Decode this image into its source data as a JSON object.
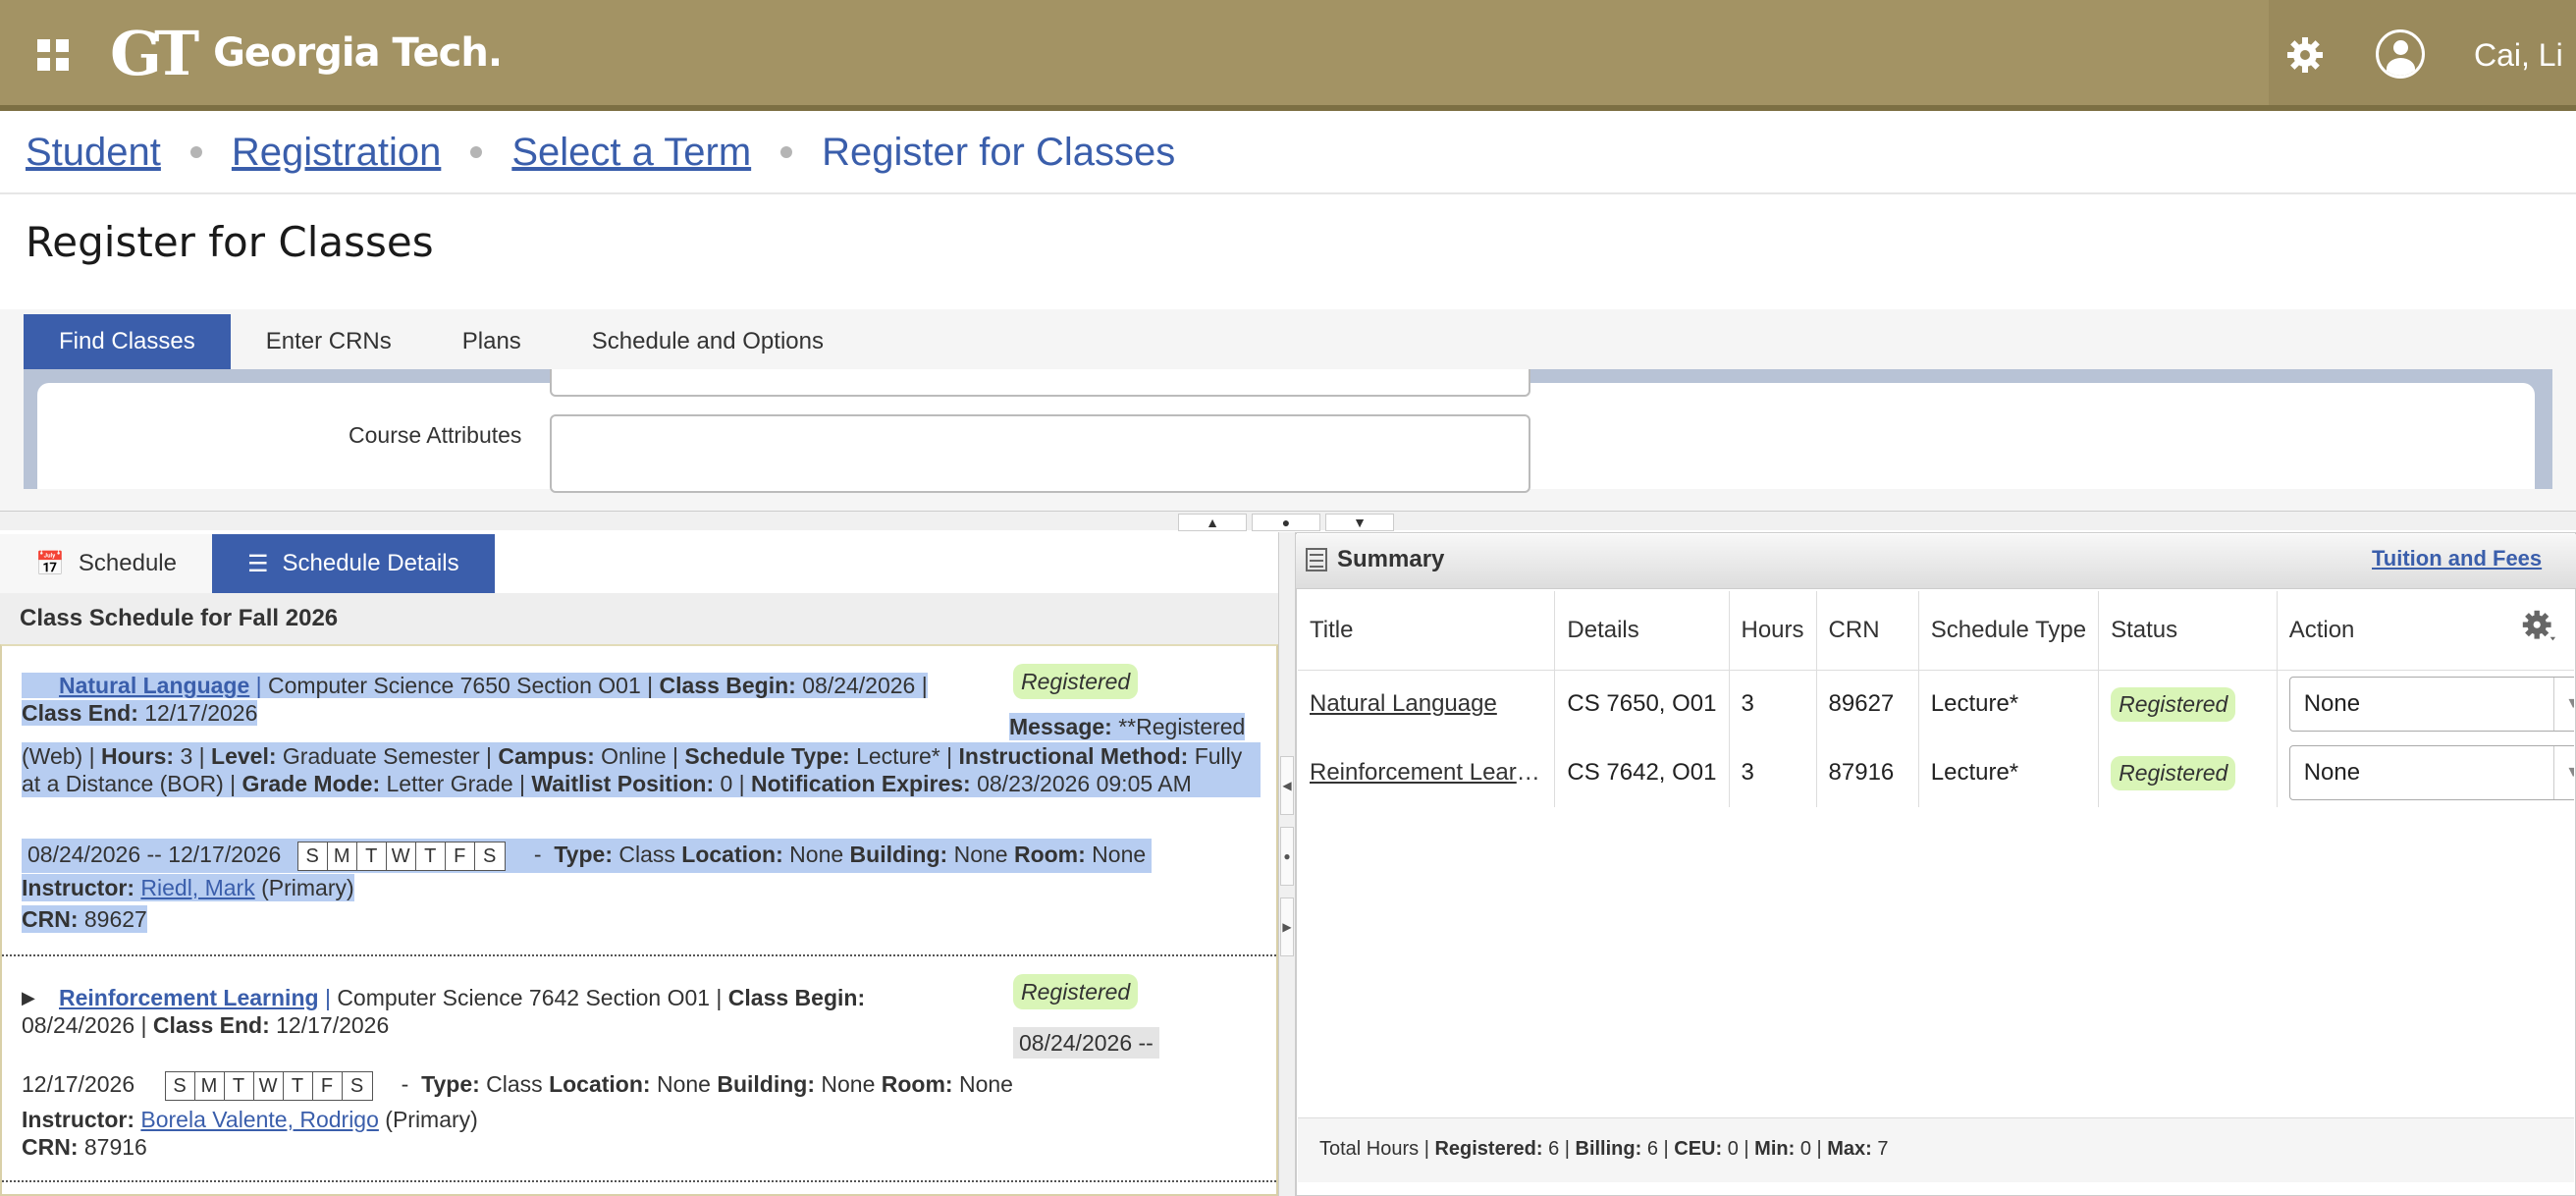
{
  "header": {
    "logo_mark": "GT",
    "logo_text": "Georgia Tech.",
    "user_name": "Cai, Li"
  },
  "breadcrumb": {
    "items": [
      "Student",
      "Registration",
      "Select a Term"
    ],
    "current": "Register for Classes"
  },
  "page_title": "Register for Classes",
  "tabs": [
    "Find Classes",
    "Enter CRNs",
    "Plans",
    "Schedule and Options"
  ],
  "search": {
    "course_attributes_label": "Course Attributes"
  },
  "schedule_tabs": [
    "Schedule",
    "Schedule Details"
  ],
  "schedule_title": "Class Schedule for Fall 2026",
  "courses": [
    {
      "title": "Natural Language",
      "sep": "|",
      "subject_section": "Computer Science 7650 Section O01 |",
      "class_begin_label": "Class Begin:",
      "class_begin": "08/24/2026 |",
      "class_end_label": "Class End:",
      "class_end": "12/17/2026",
      "status": "Registered",
      "message_label": "Message:",
      "message": "**Registered",
      "web": "(Web) |",
      "hours_label": "Hours:",
      "hours": "3 |",
      "level_label": "Level:",
      "level": "Graduate Semester |",
      "campus_label": "Campus:",
      "campus": "Online |",
      "schedule_type_label": "Schedule Type:",
      "schedule_type": "Lecture* |",
      "instructional_method_label": "Instructional Method:",
      "instructional_method": "Fully at a Distance (BOR) |",
      "grade_mode_label": "Grade Mode:",
      "grade_mode": "Letter Grade |",
      "waitlist_label": "Waitlist Position:",
      "waitlist": "0 |",
      "notification_label": "Notification Expires:",
      "notification": "08/23/2026 09:05",
      "notification_ampm": "AM",
      "date_range": "08/24/2026 -- 12/17/2026",
      "days": [
        "S",
        "M",
        "T",
        "W",
        "T",
        "F",
        "S"
      ],
      "type_label": "Type:",
      "type": "Class",
      "location_label": "Location:",
      "location": "None",
      "building_label": "Building:",
      "building": "None",
      "room_label": "Room:",
      "room": "None",
      "instructor_label": "Instructor:",
      "instructor": "Riedl, Mark",
      "instructor_role": "(Primary)",
      "crn_label": "CRN:",
      "crn": "89627"
    },
    {
      "title": "Reinforcement Learning",
      "sep": "|",
      "subject_section": "Computer Science 7642 Section O01 |",
      "class_begin_label": "Class Begin:",
      "class_begin": "08/24/2026 |",
      "class_end_label": "Class End:",
      "class_end": "12/17/2026",
      "status": "Registered",
      "date_range_start": "08/24/2026 --",
      "date_range_end": "12/17/2026",
      "days": [
        "S",
        "M",
        "T",
        "W",
        "T",
        "F",
        "S"
      ],
      "type_label": "Type:",
      "type": "Class",
      "location_label": "Location:",
      "location": "None",
      "building_label": "Building:",
      "building": "None",
      "room_label": "Room:",
      "room": "None",
      "instructor_label": "Instructor:",
      "instructor": "Borela Valente, Rodrigo",
      "instructor_role": "(Primary)",
      "crn_label": "CRN:",
      "crn": "87916"
    }
  ],
  "summary": {
    "title": "Summary",
    "tuition_link": "Tuition and Fees",
    "columns": [
      "Title",
      "Details",
      "Hours",
      "CRN",
      "Schedule Type",
      "Status",
      "Action"
    ],
    "rows": [
      {
        "title": "Natural Language",
        "details": "CS 7650, O01",
        "hours": "3",
        "crn": "89627",
        "schedule_type": "Lecture*",
        "status": "Registered",
        "action": "None"
      },
      {
        "title": "Reinforcement Learning",
        "details": "CS 7642, O01",
        "hours": "3",
        "crn": "87916",
        "schedule_type": "Lecture*",
        "status": "Registered",
        "action": "None"
      }
    ],
    "totals": {
      "prefix": "Total Hours |",
      "registered_label": "Registered:",
      "registered": "6",
      "billing_label": "Billing:",
      "billing": "6",
      "ceu_label": "CEU:",
      "ceu": "0",
      "min_label": "Min:",
      "min": "0",
      "max_label": "Max:",
      "max": "7"
    }
  },
  "colors": {
    "header_gold": "#a39364",
    "accent_blue": "#3b5eab",
    "badge_green": "#d9f5b7",
    "selection_blue": "#b7cdf1"
  },
  "icons": [
    "apps-grid-icon",
    "gear-icon",
    "user-avatar-icon",
    "calendar-icon",
    "list-icon",
    "summary-table-icon",
    "settings-gear-icon",
    "chevron-down-icon",
    "expand-arrow-icon",
    "collapse-arrow-icon"
  ]
}
